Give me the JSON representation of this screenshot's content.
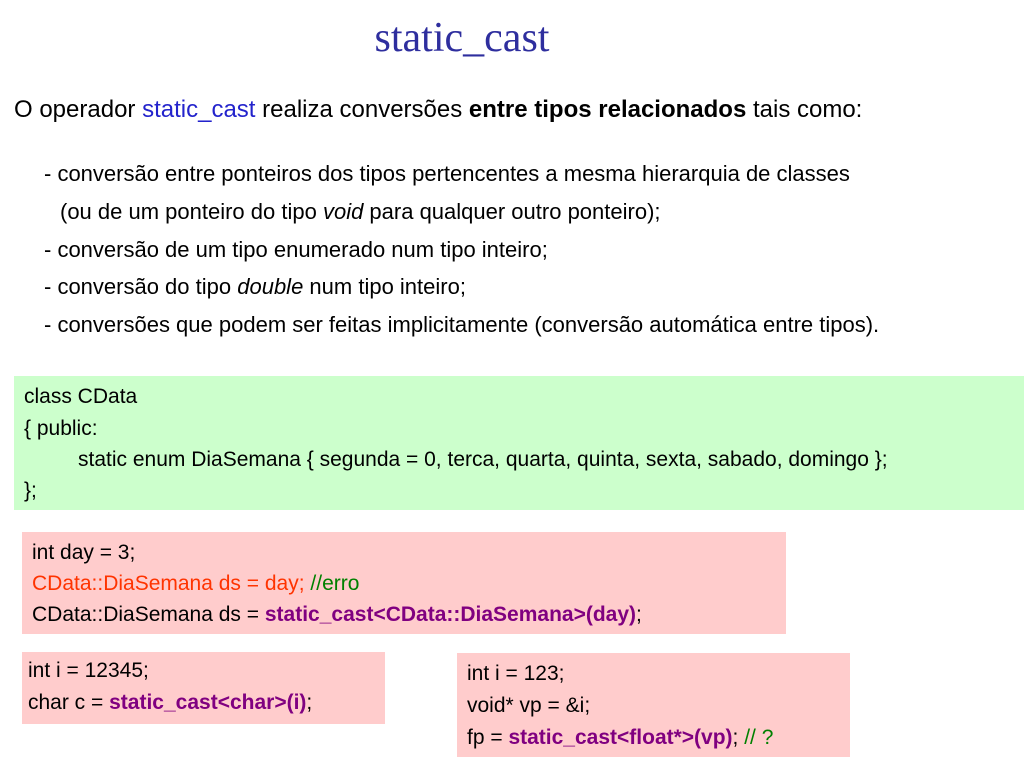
{
  "title": "static_cast",
  "intro": {
    "t1": "O operador ",
    "t2": "static_cast",
    "t3": " realiza conversões ",
    "t4": "entre tipos relacionados",
    "t5": " tais como:"
  },
  "bullets": {
    "b1": "- conversão entre ponteiros dos tipos pertencentes a mesma hierarquia de classes",
    "b2a": "(ou de um ponteiro do tipo ",
    "b2b": "void",
    "b2c": " para qualquer outro ponteiro);",
    "b3": "- conversão de um tipo enumerado num tipo inteiro;",
    "b4a": "- conversão do tipo ",
    "b4b": "double",
    "b4c": " num tipo inteiro;",
    "b5": "- conversões que podem ser feitas implicitamente (conversão automática entre tipos)."
  },
  "code1": {
    "l1": "class CData",
    "l2": "{  public:",
    "l3": "static enum DiaSemana { segunda = 0, terca, quarta, quinta, sexta, sabado, domingo };",
    "l4": "};"
  },
  "code2": {
    "l1": "int day = 3;",
    "l2a": "CData::DiaSemana ds = day; ",
    "l2b": "//erro",
    "l3a": "CData::DiaSemana ds = ",
    "l3b": "static_cast<CData::DiaSemana>(day)",
    "l3c": ";"
  },
  "code3": {
    "l1": "int i = 12345;",
    "l2a": "char c = ",
    "l2b": "static_cast<char>(i)",
    "l2c": ";"
  },
  "code4": {
    "l1": "int i = 123;",
    "l2": "void* vp = &i;",
    "l3a": "fp = ",
    "l3b": "static_cast<float*>(vp)",
    "l3c": "; ",
    "l3d": "// ?"
  },
  "colors": {
    "title": "#2e2e9e",
    "keyword_blue": "#2323cc",
    "cast": "#800080",
    "error": "#ff3300",
    "comment": "#008000",
    "green_box": "#ccffcc",
    "pink_box": "#ffcccc"
  }
}
